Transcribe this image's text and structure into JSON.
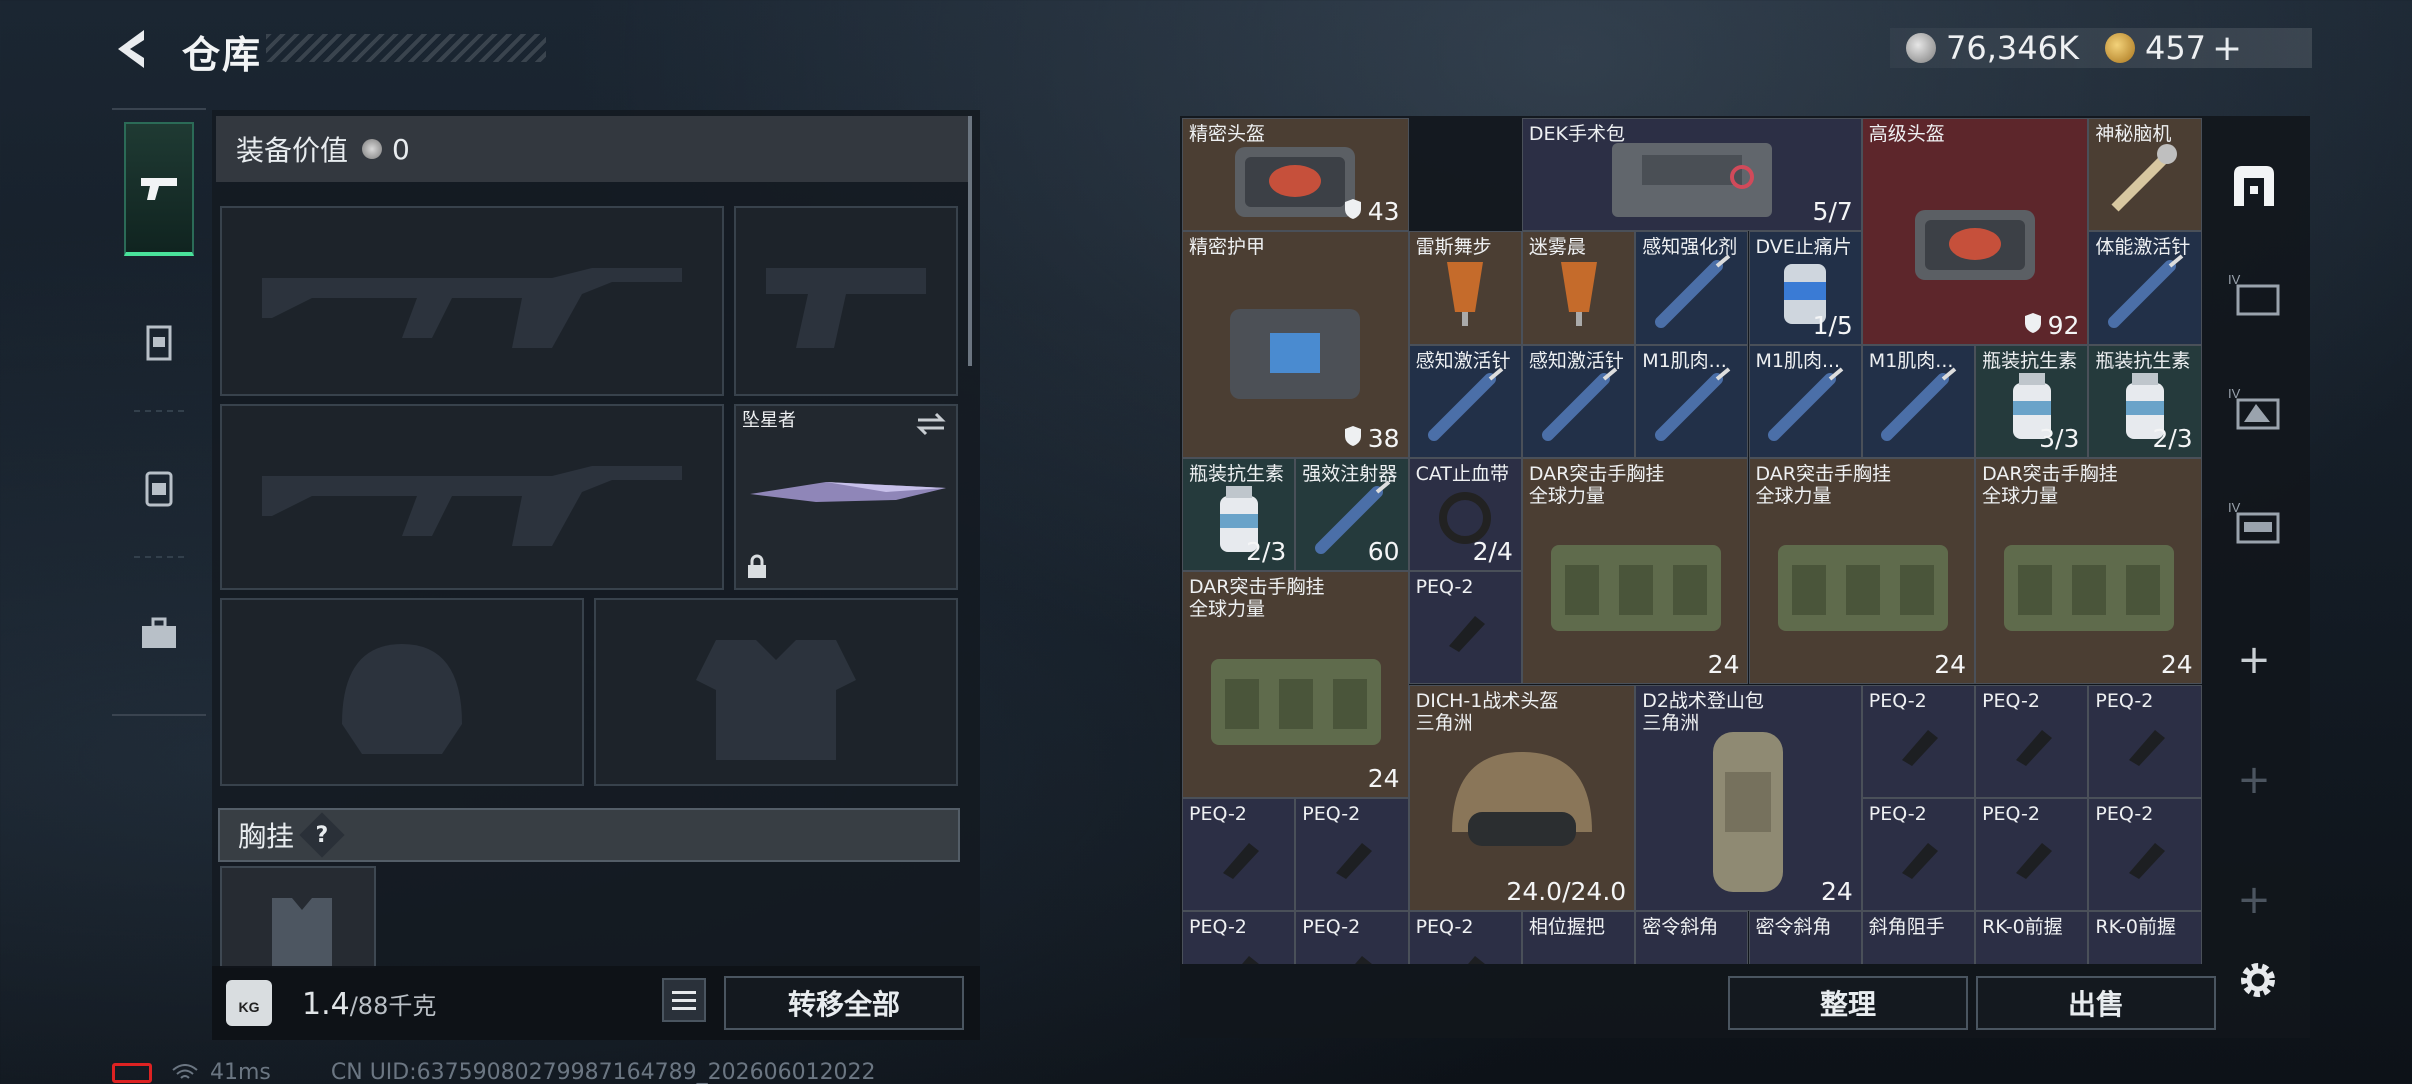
{
  "header": {
    "title": "仓库",
    "silver": "76,346K",
    "gold": "457",
    "add_gold": "+"
  },
  "equipment": {
    "value_label": "装备价值",
    "value": "0",
    "melee_name": "坠星者",
    "chest_label": "胸挂",
    "help": "?"
  },
  "footer": {
    "weight": "1.4",
    "weight_max": "/88千克",
    "transfer_all": "转移全部",
    "sort": "整理",
    "sell": "出售"
  },
  "status": {
    "ping": "41ms",
    "uid": "CN UID:637590802799871647​89_202606012022"
  },
  "items": [
    {
      "name": "精密头盔",
      "value": "43",
      "badge": "shield"
    },
    {
      "name": "DEK手术包",
      "value": "5/7"
    },
    {
      "name": "高级头盔",
      "value": "92",
      "badge": "shield"
    },
    {
      "name": "神秘脑机",
      "value": ""
    },
    {
      "name": "精密护甲",
      "value": "38",
      "badge": "shield"
    },
    {
      "name": "雷斯舞步",
      "value": ""
    },
    {
      "name": "迷雾晨",
      "value": ""
    },
    {
      "name": "感知强化剂",
      "value": ""
    },
    {
      "name": "DVE止痛片",
      "value": "1/5"
    },
    {
      "name": "体能激活针",
      "value": ""
    },
    {
      "name": "感知激活针",
      "value": ""
    },
    {
      "name": "感知激活针",
      "value": ""
    },
    {
      "name": "M1肌肉...",
      "value": ""
    },
    {
      "name": "M1肌肉...",
      "value": ""
    },
    {
      "name": "M1肌肉...",
      "value": ""
    },
    {
      "name": "瓶装抗生素",
      "value": "3/3"
    },
    {
      "name": "瓶装抗生素",
      "value": "2/3"
    },
    {
      "name": "瓶装抗生素",
      "value": "2/3"
    },
    {
      "name": "强效注射器",
      "value": "60"
    },
    {
      "name": "CAT止血带",
      "value": "2/4"
    },
    {
      "name": "DAR突击手胸挂\n全球力量",
      "value": "24"
    },
    {
      "name": "DAR突击手胸挂\n全球力量",
      "value": "24"
    },
    {
      "name": "DAR突击手胸挂\n全球力量",
      "value": "24"
    },
    {
      "name": "DAR突击手胸挂\n全球力量",
      "value": "24"
    },
    {
      "name": "PEQ-2",
      "value": ""
    },
    {
      "name": "DICH-1战术头盔\n三角洲",
      "value": "24.0/24.0"
    },
    {
      "name": "D2战术登山包\n三角洲",
      "value": "24"
    },
    {
      "name": "PEQ-2",
      "value": ""
    },
    {
      "name": "PEQ-2",
      "value": ""
    },
    {
      "name": "PEQ-2",
      "value": ""
    },
    {
      "name": "PEQ-2",
      "value": ""
    },
    {
      "name": "PEQ-2",
      "value": ""
    },
    {
      "name": "PEQ-2",
      "value": ""
    },
    {
      "name": "PEQ-2",
      "value": ""
    },
    {
      "name": "PEQ-2",
      "value": ""
    },
    {
      "name": "PEQ-2",
      "value": ""
    },
    {
      "name": "PEQ-2",
      "value": ""
    },
    {
      "name": "PEQ-2",
      "value": ""
    },
    {
      "name": "相位握把",
      "value": ""
    },
    {
      "name": "密令斜角",
      "value": ""
    },
    {
      "name": "密令斜角",
      "value": ""
    },
    {
      "name": "斜角阻手",
      "value": ""
    },
    {
      "name": "RK-0前握",
      "value": ""
    },
    {
      "name": "RK-0前握",
      "value": ""
    }
  ],
  "right_tabs": [
    "safe-box",
    "IV-shelf-1",
    "IV-shelf-2",
    "IV-shelf-3",
    "+",
    "+",
    "+"
  ]
}
